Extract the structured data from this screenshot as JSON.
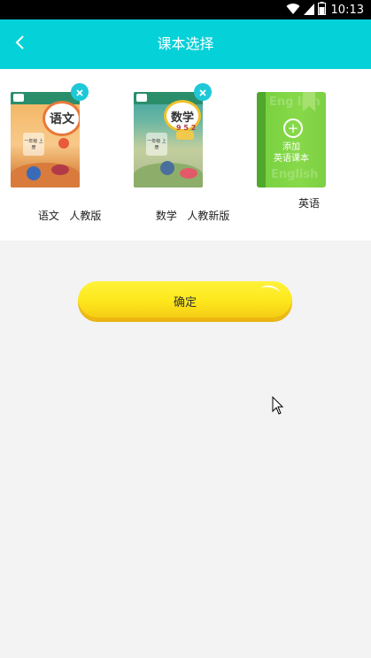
{
  "status_bar": {
    "time": "10:13",
    "icons": [
      "wifi-icon",
      "cell-signal-icon",
      "battery-icon"
    ]
  },
  "nav": {
    "title": "课本选择",
    "back_icon": "chevron-left-icon"
  },
  "books": [
    {
      "subject": "语文",
      "edition": "人教版",
      "cover_title": "语文",
      "cover_grade": "一年级 上册"
    },
    {
      "subject": "数学",
      "edition": "人教新版",
      "cover_title": "数学",
      "cover_grade": "一年级 上册",
      "cover_digits": "9 5 2"
    }
  ],
  "add_english": {
    "line1": "添加",
    "line2": "英语课本",
    "watermark_top": "Eng lish",
    "watermark_bottom": "English",
    "label": "英语"
  },
  "confirm": {
    "label": "确定"
  },
  "colors": {
    "nav": "#05d1d8",
    "remove_badge": "#1fc8d7",
    "add_card": "#7ad241",
    "confirm": "#fde81c"
  }
}
